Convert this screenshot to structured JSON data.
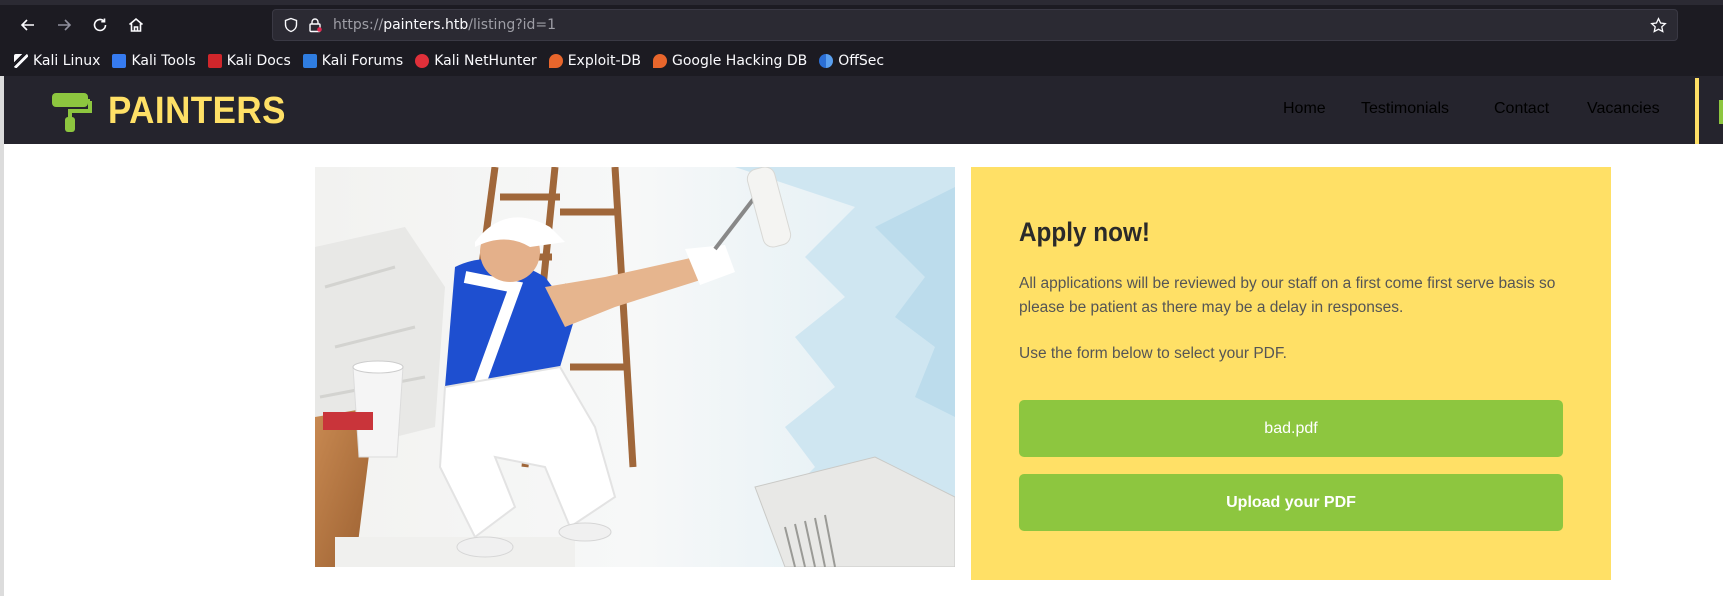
{
  "browser": {
    "url_scheme": "https://",
    "url_host": "painters.htb",
    "url_path": "/listing?id=1",
    "bookmarks": [
      {
        "label": "Kali Linux",
        "icon": "kali-dragon-icon"
      },
      {
        "label": "Kali Tools",
        "icon": "kali-tools-icon"
      },
      {
        "label": "Kali Docs",
        "icon": "kali-docs-icon"
      },
      {
        "label": "Kali Forums",
        "icon": "kali-forums-icon"
      },
      {
        "label": "Kali NetHunter",
        "icon": "kali-nethunter-icon"
      },
      {
        "label": "Exploit-DB",
        "icon": "exploit-db-icon"
      },
      {
        "label": "Google Hacking DB",
        "icon": "google-hacking-db-icon"
      },
      {
        "label": "OffSec",
        "icon": "offsec-icon"
      }
    ]
  },
  "site": {
    "logo_text": "PAINTERS",
    "nav": [
      "Home",
      "Testimonials",
      "Contact",
      "Vacancies"
    ]
  },
  "apply": {
    "title": "Apply now!",
    "paragraph1": "All applications will be reviewed by our staff on a first come first serve basis so please be patient as there may be a delay in responses.",
    "paragraph2": "Use the form below to select your PDF.",
    "file_button": "bad.pdf",
    "upload_button": "Upload your PDF"
  },
  "colors": {
    "accent_yellow": "#ffe066",
    "accent_green": "#8dc63f",
    "header_dark": "#25242d"
  }
}
